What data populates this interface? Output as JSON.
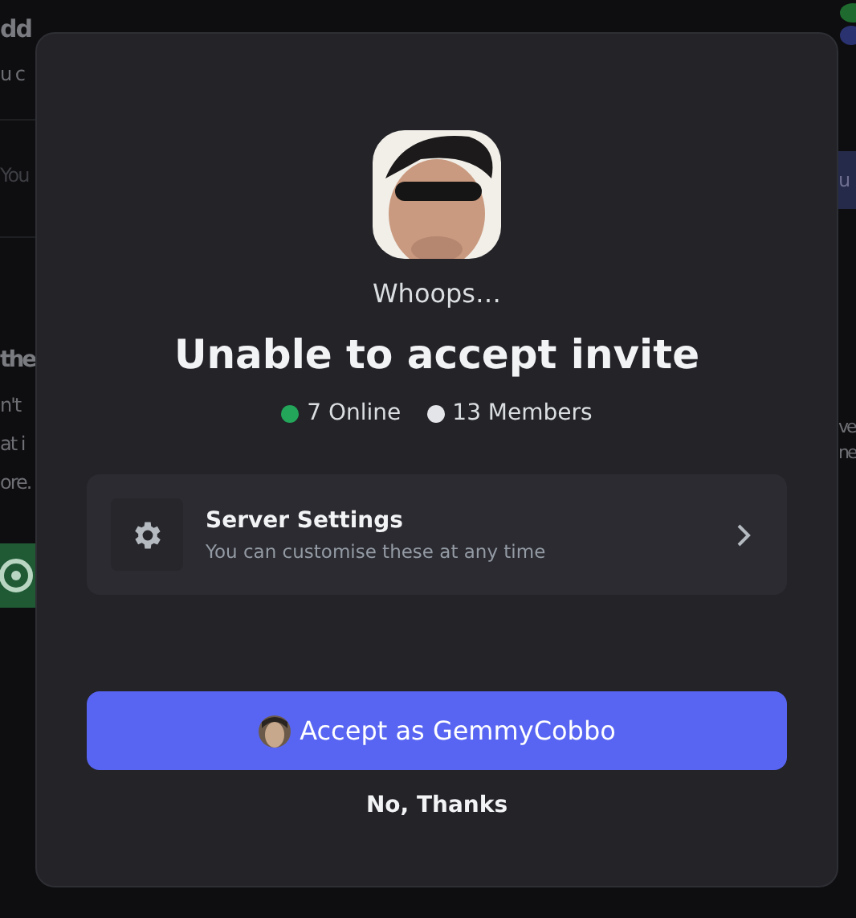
{
  "background": {
    "left_texts": [
      "dd",
      "u c",
      "You",
      "the",
      "n't",
      "at i",
      "ore."
    ],
    "right_texts": [
      "u",
      "ve",
      "ne"
    ]
  },
  "modal": {
    "subtitle": "Whoops…",
    "title": "Unable to accept invite",
    "stats": [
      {
        "label": "7 Online",
        "color": "#23a55a"
      },
      {
        "label": "13 Members",
        "color": "#e3e5e8"
      }
    ],
    "settings": {
      "title": "Server Settings",
      "description": "You can customise these at any time"
    },
    "accept_button": "Accept as GemmyCobbo",
    "decline_button": "No, Thanks"
  }
}
